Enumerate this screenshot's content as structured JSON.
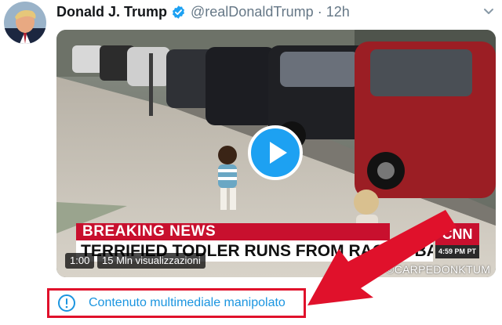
{
  "tweet": {
    "author": {
      "display_name": "Donald J. Trump",
      "handle": "@realDonaldTrump",
      "verified": true
    },
    "time": "12h",
    "separator": "·",
    "media": {
      "chyron_top": "BREAKING NEWS",
      "chyron_bottom": "TERRIFIED TODLER RUNS FROM RACIST BABY",
      "network_logo": "CNN",
      "network_time": "4:59 PM PT",
      "watermark": "©CARPEDONKTUM",
      "duration": "1:00",
      "views": "15 Mln visualizzazioni"
    },
    "notice": {
      "label": "Contenuto multimediale manipolato",
      "icon": "exclamation-circle-icon"
    }
  },
  "colors": {
    "link_blue": "#1b95e0",
    "play_blue": "#1da1f2",
    "highlight_red": "#e0112b",
    "verified_blue": "#1da1f2",
    "cnn_red": "#c8102e"
  },
  "icons": {
    "verified": "verified-badge-icon",
    "caret": "chevron-down-icon",
    "play": "play-icon",
    "annotation_arrow": "red-arrow-annotation"
  }
}
